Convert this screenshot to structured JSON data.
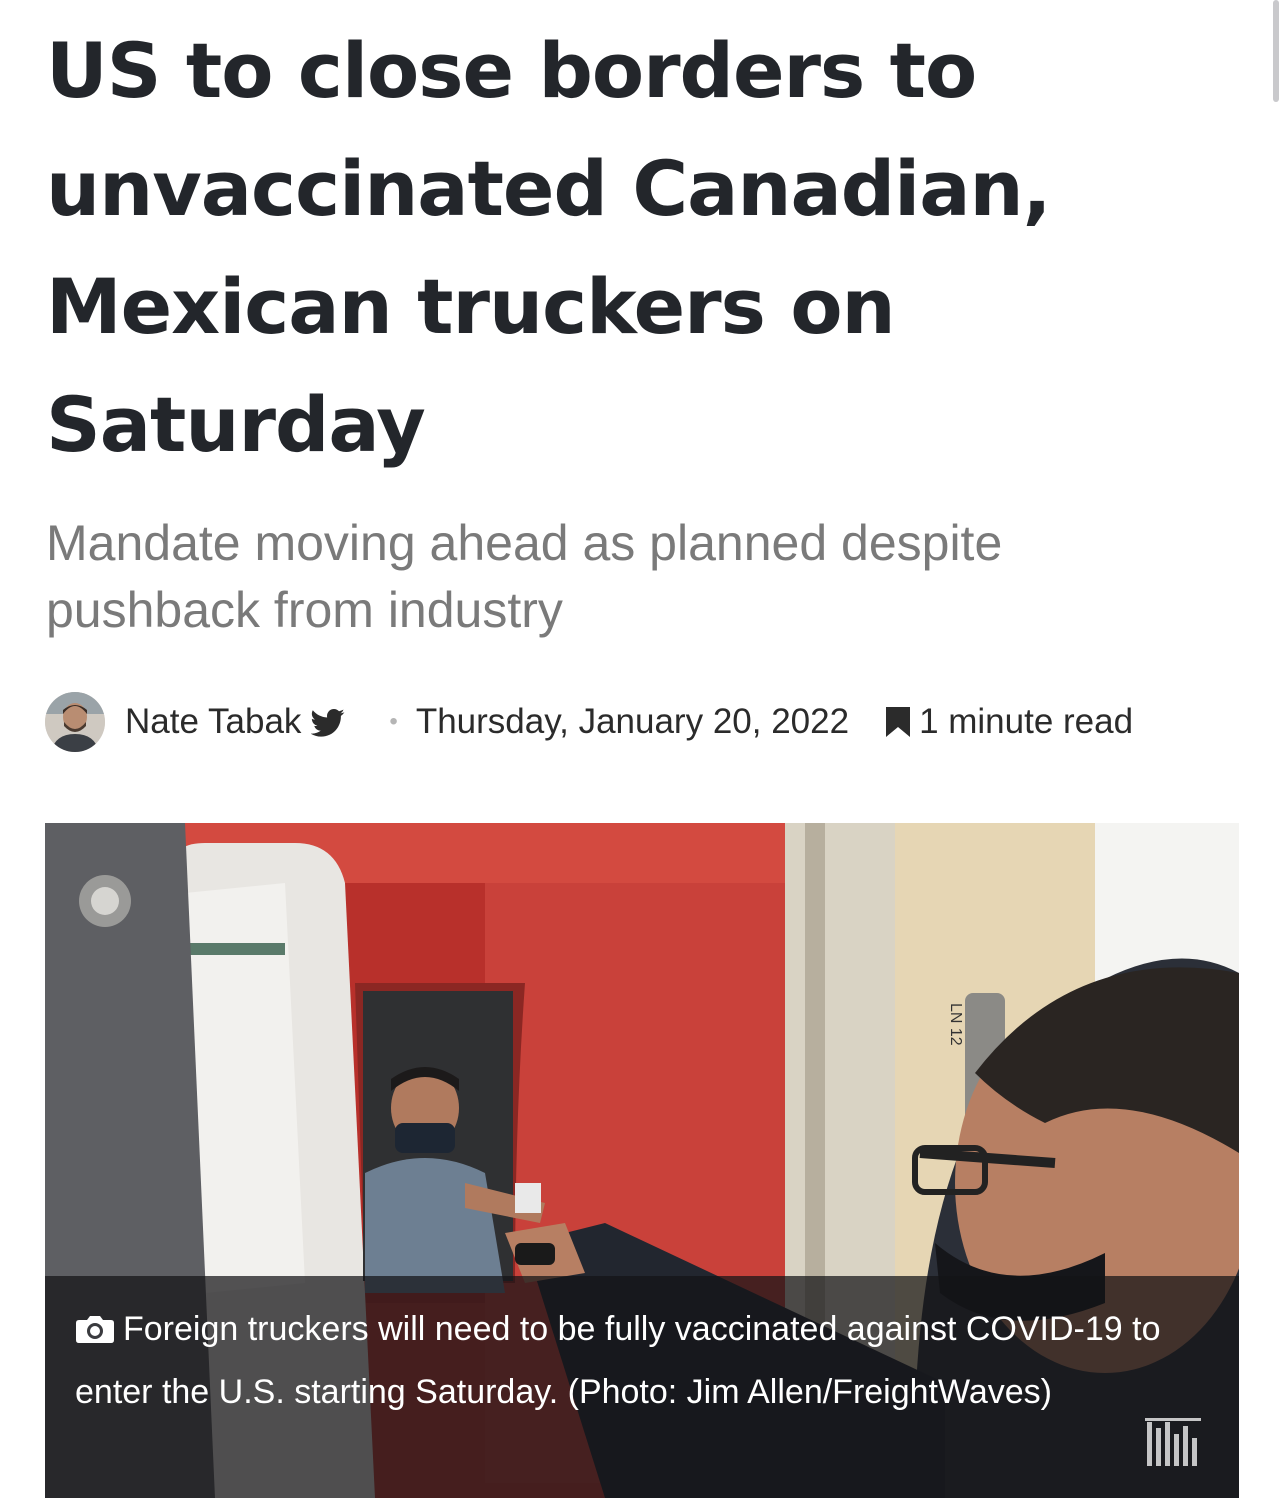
{
  "article": {
    "headline": "US to close borders to unvaccinated Canadian, Mexican truckers on Saturday",
    "subtitle": "Mandate moving ahead as planned despite pushback from industry",
    "author": "Nate Tabak",
    "separator": "•",
    "date": "Thursday, January 20, 2022",
    "read_time": "1 minute read",
    "author_social_icon": "twitter-icon",
    "read_time_icon": "bookmark-icon"
  },
  "photo": {
    "caption": "Foreign truckers will need to be fully vaccinated against COVID-19 to enter the U.S. starting Saturday. (Photo: Jim Allen/FreightWaves)",
    "caption_icon": "camera-icon",
    "watermark_icon": "freightwaves-logo-icon",
    "door_label": "LN 12"
  },
  "colors": {
    "headline": "#23262b",
    "subtitle": "#7a7a7a",
    "truck_red": "#c7372f",
    "caption_overlay": "#141416"
  }
}
